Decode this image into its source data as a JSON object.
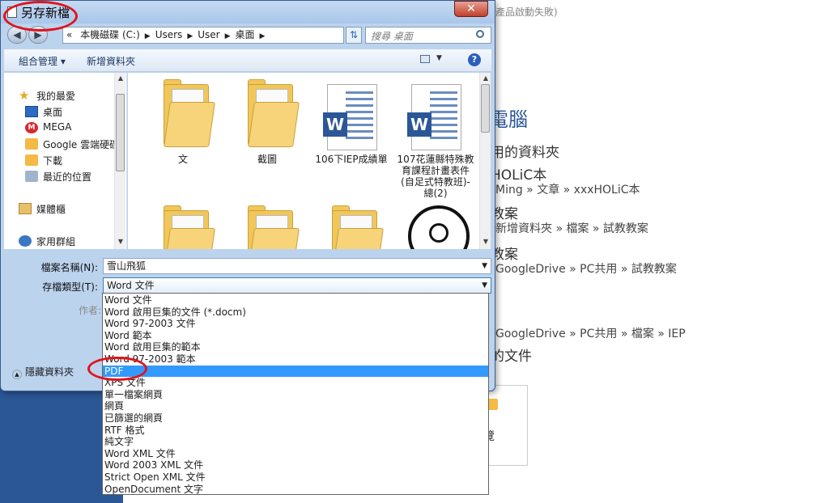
{
  "background": {
    "note": "產品啟動失敗)",
    "title_frag": "電腦",
    "lines": [
      {
        "text": "用的資料夾",
        "cls": "bg-lg"
      },
      {
        "text": "HOLiC本",
        "cls": "bg-lg"
      },
      {
        "text": "Ming » 文章 » xxxHOLiC本",
        "cls": "bg-sm"
      },
      {
        "text": "教案",
        "cls": "bg-lg"
      },
      {
        "text": "新增資料夾 » 檔案 » 試教教案",
        "cls": "bg-sm"
      },
      {
        "text": "教案",
        "cls": "bg-lg"
      },
      {
        "text": "GoogleDrive » PC共用 » 試教教案",
        "cls": "bg-sm"
      },
      {
        "text": "GoogleDrive » PC共用 » 檔案 » IEP",
        "cls": "bg-sm"
      },
      {
        "text": "的文件",
        "cls": "bg-lg"
      }
    ],
    "card_label": "覽"
  },
  "dialog": {
    "title": "另存新檔",
    "close_symbol": "✕",
    "address": {
      "lead": "«",
      "crumbs": [
        "本機磁碟 (C:)",
        "Users",
        "User",
        "桌面"
      ]
    },
    "search_placeholder": "搜尋 桌面",
    "toolbar": {
      "organize": "組合管理 ▾",
      "new_folder": "新增資料夾"
    },
    "nav_items": [
      {
        "label": "我的最愛",
        "icon": "star-icon"
      },
      {
        "label": "桌面",
        "icon": "desktop-icon"
      },
      {
        "label": "MEGA",
        "icon": "mega-icon"
      },
      {
        "label": "Google 雲端硬碟",
        "icon": "google-drive-icon"
      },
      {
        "label": "下載",
        "icon": "downloads-icon"
      },
      {
        "label": "最近的位置",
        "icon": "recent-places-icon"
      },
      {
        "label": "媒體櫃",
        "icon": "library-icon"
      },
      {
        "label": "家用群組",
        "icon": "homegroup-icon"
      }
    ],
    "files": [
      {
        "label": "文",
        "kind": "folder"
      },
      {
        "label": "截圖",
        "kind": "folder"
      },
      {
        "label": "106下IEP成績單",
        "kind": "word"
      },
      {
        "label": "107花蓮縣特殊教育課程計畫表件(自足式特教班)-總(2)",
        "kind": "word"
      },
      {
        "label": "",
        "kind": "folder"
      },
      {
        "label": "",
        "kind": "folder"
      },
      {
        "label": "",
        "kind": "folder"
      },
      {
        "label": "",
        "kind": "image"
      }
    ],
    "filename_label": "檔案名稱(N):",
    "filename_value": "雪山飛狐",
    "filetype_label": "存檔類型(T):",
    "filetype_value": "Word 文件",
    "author_label": "作者:",
    "hide_folders": "隱藏資料夾",
    "type_options": [
      "Word 文件",
      "Word 啟用巨集的文件 (*.docm)",
      "Word 97-2003 文件",
      "Word 範本",
      "Word 啟用巨集的範本",
      "Word 97-2003 範本",
      "PDF",
      "XPS 文件",
      "單一檔案網頁",
      "網頁",
      "已篩選的網頁",
      "RTF 格式",
      "純文字",
      "Word XML 文件",
      "Word 2003 XML 文件",
      "Strict Open XML 文件",
      "OpenDocument 文字"
    ],
    "highlighted_option": "PDF"
  },
  "colors": {
    "highlight": "#3399ff",
    "annotation": "#e0141b",
    "word_blue": "#2b5797"
  }
}
